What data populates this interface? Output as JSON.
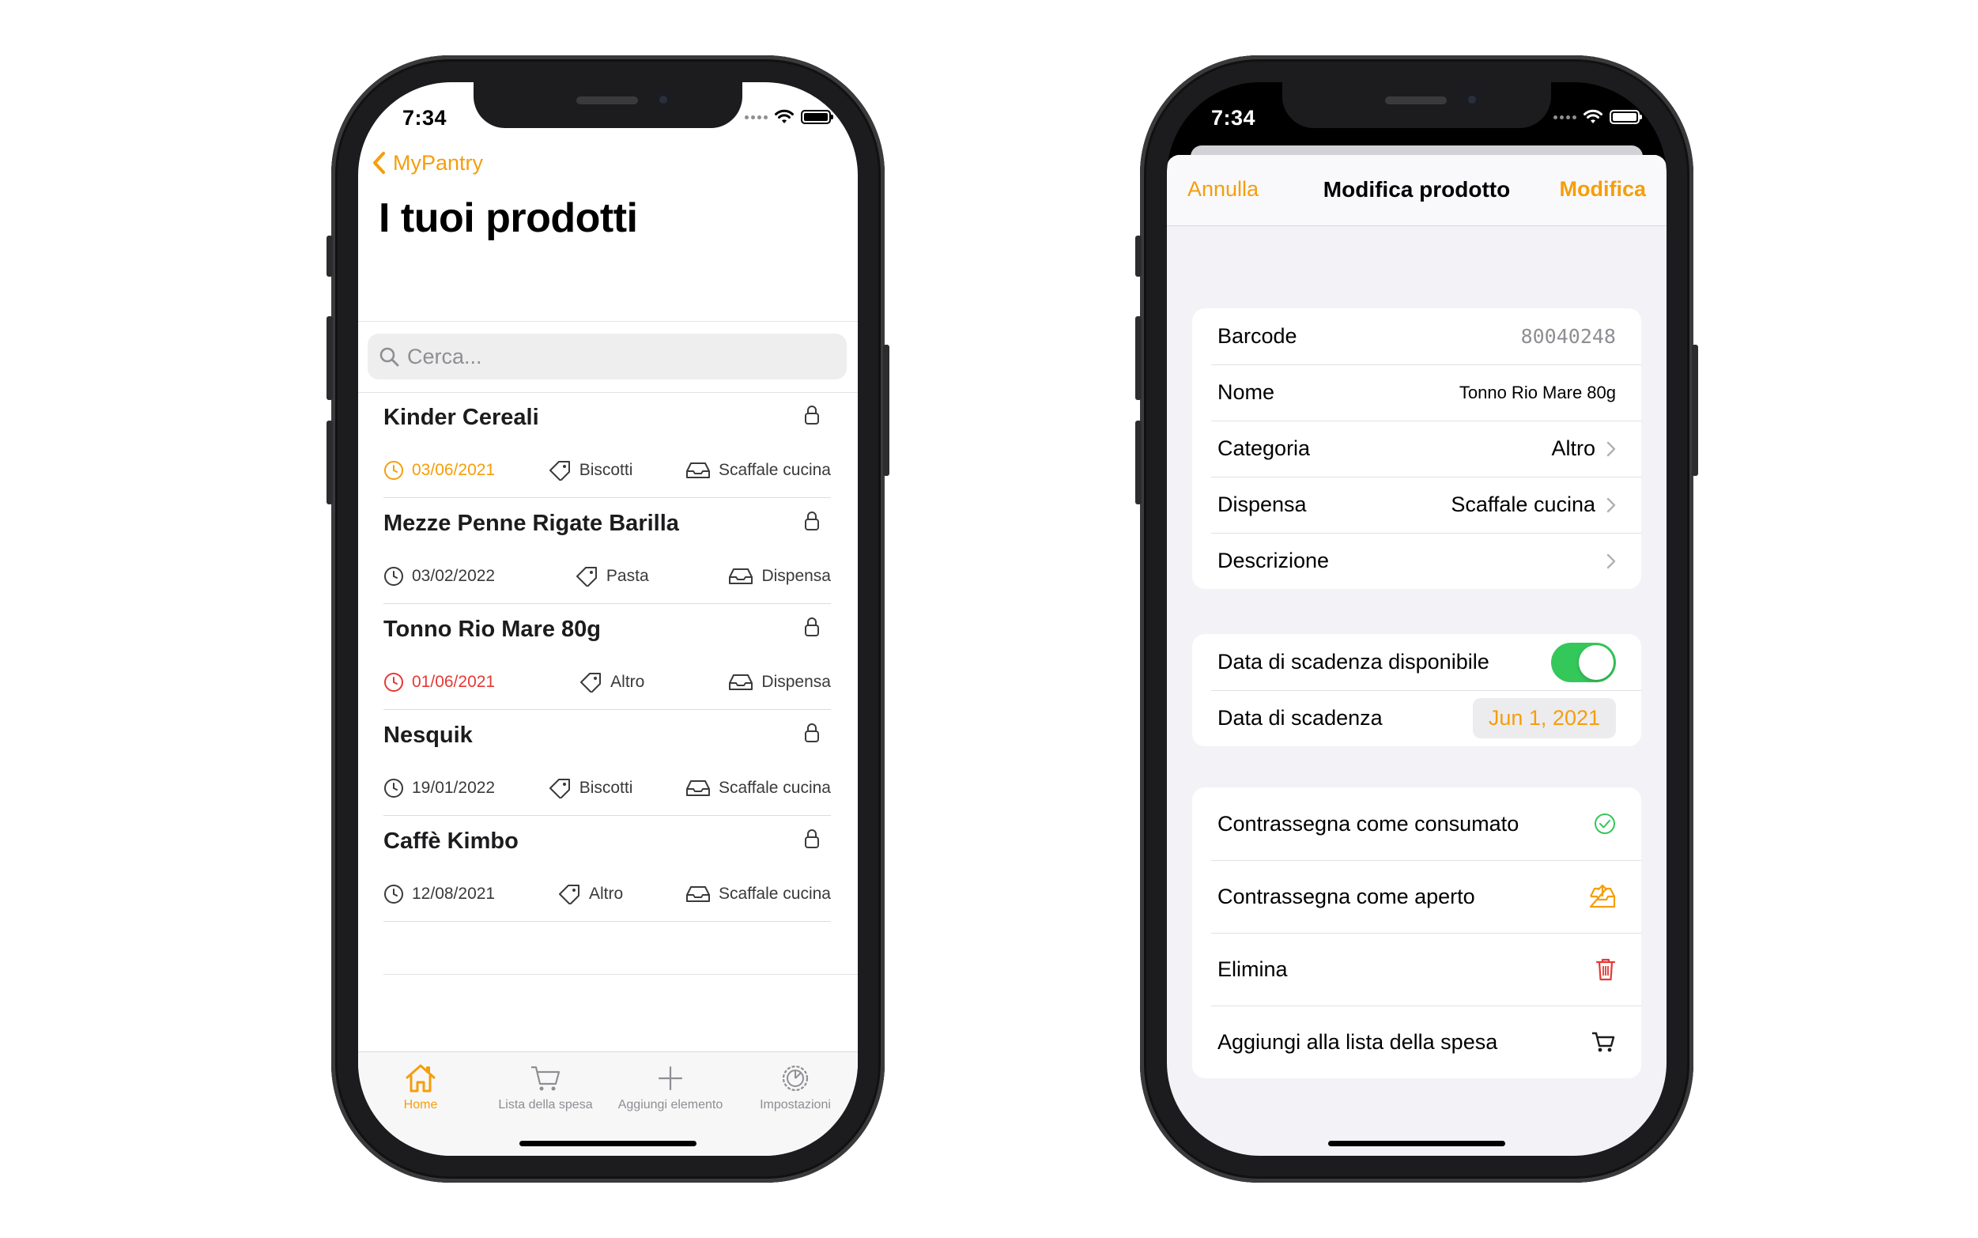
{
  "left_phone": {
    "status": {
      "time": "7:34"
    },
    "nav": {
      "back_label": "MyPantry"
    },
    "title": "I tuoi prodotti",
    "search": {
      "placeholder": "Cerca..."
    },
    "products": [
      {
        "name": "Kinder Cereali",
        "date": "03/06/2021",
        "date_state": "warn",
        "category": "Biscotti",
        "location": "Scaffale cucina"
      },
      {
        "name": "Mezze Penne Rigate Barilla",
        "date": "03/02/2022",
        "date_state": "normal",
        "category": "Pasta",
        "location": "Dispensa"
      },
      {
        "name": "Tonno Rio Mare 80g",
        "date": "01/06/2021",
        "date_state": "expired",
        "category": "Altro",
        "location": "Dispensa"
      },
      {
        "name": "Nesquik",
        "date": "19/01/2022",
        "date_state": "normal",
        "category": "Biscotti",
        "location": "Scaffale cucina"
      },
      {
        "name": "Caffè Kimbo",
        "date": "12/08/2021",
        "date_state": "normal",
        "category": "Altro",
        "location": "Scaffale cucina"
      }
    ],
    "tabbar": {
      "home": "Home",
      "shopping_list": "Lista della spesa",
      "add_item": "Aggiungi elemento",
      "settings": "Impostazioni"
    }
  },
  "right_phone": {
    "status": {
      "time": "7:34"
    },
    "header": {
      "cancel": "Annulla",
      "title": "Modifica prodotto",
      "confirm": "Modifica"
    },
    "details": {
      "barcode_label": "Barcode",
      "barcode_value": "80040248",
      "name_label": "Nome",
      "name_value": "Tonno Rio Mare 80g",
      "category_label": "Categoria",
      "category_value": "Altro",
      "pantry_label": "Dispensa",
      "pantry_value": "Scaffale cucina",
      "description_label": "Descrizione"
    },
    "expiry": {
      "available_label": "Data di scadenza disponibile",
      "available_on": true,
      "date_label": "Data di scadenza",
      "date_value": "Jun 1, 2021"
    },
    "actions": {
      "consumed": "Contrassegna come consumato",
      "opened": "Contrassegna come aperto",
      "delete": "Elimina",
      "add_to_list": "Aggiungi alla lista della spesa"
    }
  },
  "colors": {
    "accent": "#f59e0b",
    "expired": "#e53935",
    "toggle_on": "#34c759"
  }
}
